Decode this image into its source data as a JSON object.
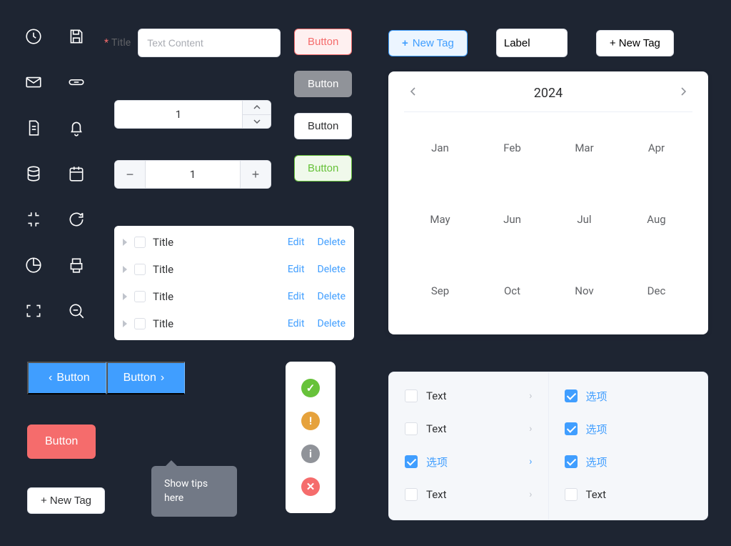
{
  "form": {
    "title_label": "Title",
    "placeholder": "Text Content"
  },
  "buttons": {
    "danger_outline": "Button",
    "info_solid": "Button",
    "plain": "Button",
    "success_outline": "Button",
    "primary_left": "Button",
    "primary_right": "Button",
    "danger_solid": "Button",
    "newtag_bottom": "+ New Tag"
  },
  "number_a": {
    "value": "1"
  },
  "number_b": {
    "value": "1"
  },
  "tree": {
    "rows": [
      {
        "title": "Title",
        "edit": "Edit",
        "delete": "Delete"
      },
      {
        "title": "Title",
        "edit": "Edit",
        "delete": "Delete"
      },
      {
        "title": "Title",
        "edit": "Edit",
        "delete": "Delete"
      },
      {
        "title": "Title",
        "edit": "Edit",
        "delete": "Delete"
      }
    ]
  },
  "tags": {
    "new_primary": "New Tag",
    "label_input": "Label",
    "new_plain": "+ New Tag"
  },
  "calendar": {
    "year": "2024",
    "months": [
      "Jan",
      "Feb",
      "Mar",
      "Apr",
      "May",
      "Jun",
      "Jul",
      "Aug",
      "Sep",
      "Oct",
      "Nov",
      "Dec"
    ]
  },
  "tooltip": {
    "text": "Show tips here"
  },
  "transfer": {
    "left": [
      {
        "label": "Text",
        "checked": false
      },
      {
        "label": "Text",
        "checked": false
      },
      {
        "label": "选项",
        "checked": true
      },
      {
        "label": "Text",
        "checked": false
      }
    ],
    "right": [
      {
        "label": "选项",
        "checked": true
      },
      {
        "label": "选项",
        "checked": true
      },
      {
        "label": "选项",
        "checked": true
      },
      {
        "label": "Text",
        "checked": false
      }
    ]
  }
}
